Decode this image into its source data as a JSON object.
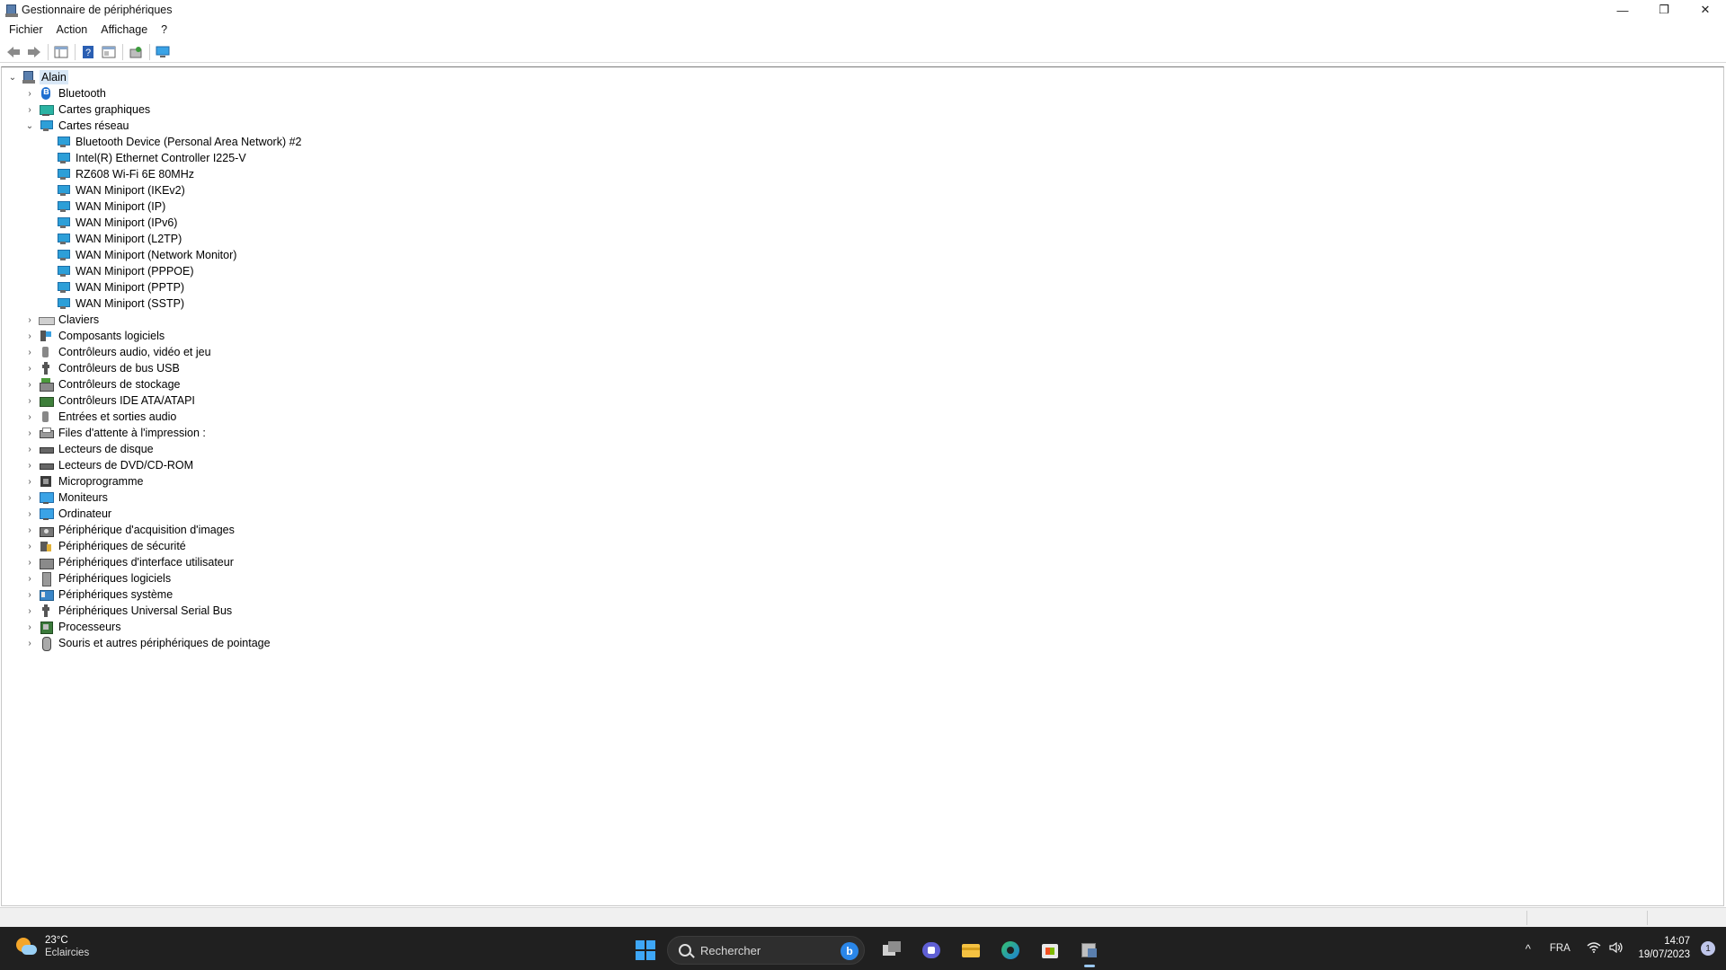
{
  "window": {
    "title": "Gestionnaire de périphériques",
    "minimize": "—",
    "restore": "❐",
    "close": "✕"
  },
  "menu": [
    "Fichier",
    "Action",
    "Affichage",
    "?"
  ],
  "tree": {
    "root": "Alain",
    "categories": [
      {
        "label": "Bluetooth",
        "icon": "bluetooth-icon",
        "expanded": false
      },
      {
        "label": "Cartes graphiques",
        "icon": "display-adapter-icon",
        "expanded": false
      },
      {
        "label": "Cartes réseau",
        "icon": "network-adapter-icon",
        "expanded": true,
        "children": [
          "Bluetooth Device (Personal Area Network) #2",
          "Intel(R) Ethernet Controller I225-V",
          "RZ608 Wi-Fi 6E 80MHz",
          "WAN Miniport (IKEv2)",
          "WAN Miniport (IP)",
          "WAN Miniport (IPv6)",
          "WAN Miniport (L2TP)",
          "WAN Miniport (Network Monitor)",
          "WAN Miniport (PPPOE)",
          "WAN Miniport (PPTP)",
          "WAN Miniport (SSTP)"
        ]
      },
      {
        "label": "Claviers",
        "icon": "keyboard-icon",
        "expanded": false
      },
      {
        "label": "Composants logiciels",
        "icon": "software-component-icon",
        "expanded": false
      },
      {
        "label": "Contrôleurs audio, vidéo et jeu",
        "icon": "audio-icon",
        "expanded": false
      },
      {
        "label": "Contrôleurs de bus USB",
        "icon": "usb-icon",
        "expanded": false
      },
      {
        "label": "Contrôleurs de stockage",
        "icon": "storage-controller-icon",
        "expanded": false
      },
      {
        "label": "Contrôleurs IDE ATA/ATAPI",
        "icon": "ide-controller-icon",
        "expanded": false
      },
      {
        "label": "Entrées et sorties audio",
        "icon": "audio-io-icon",
        "expanded": false
      },
      {
        "label": "Files d'attente à l'impression :",
        "icon": "print-queue-icon",
        "expanded": false
      },
      {
        "label": "Lecteurs de disque",
        "icon": "disk-drive-icon",
        "expanded": false
      },
      {
        "label": "Lecteurs de DVD/CD-ROM",
        "icon": "dvd-drive-icon",
        "expanded": false
      },
      {
        "label": "Microprogramme",
        "icon": "firmware-icon",
        "expanded": false
      },
      {
        "label": "Moniteurs",
        "icon": "monitor-icon",
        "expanded": false
      },
      {
        "label": "Ordinateur",
        "icon": "computer-icon",
        "expanded": false
      },
      {
        "label": "Périphérique d'acquisition d'images",
        "icon": "imaging-device-icon",
        "expanded": false
      },
      {
        "label": "Périphériques de sécurité",
        "icon": "security-device-icon",
        "expanded": false
      },
      {
        "label": "Périphériques d'interface utilisateur",
        "icon": "hid-icon",
        "expanded": false
      },
      {
        "label": "Périphériques logiciels",
        "icon": "software-device-icon",
        "expanded": false
      },
      {
        "label": "Périphériques système",
        "icon": "system-device-icon",
        "expanded": false
      },
      {
        "label": "Périphériques Universal Serial Bus",
        "icon": "usb-device-icon",
        "expanded": false
      },
      {
        "label": "Processeurs",
        "icon": "processor-icon",
        "expanded": false
      },
      {
        "label": "Souris et autres périphériques de pointage",
        "icon": "mouse-icon",
        "expanded": false
      }
    ]
  },
  "taskbar": {
    "weather_temp": "23°C",
    "weather_desc": "Eclaircies",
    "search_placeholder": "Rechercher",
    "language": "FRA",
    "time": "14:07",
    "date": "19/07/2023",
    "notification_count": "1"
  },
  "colors": {
    "taskbar_bg": "#202020",
    "selection_bg": "#d9e8f7",
    "accent": "#3ea7f7"
  }
}
